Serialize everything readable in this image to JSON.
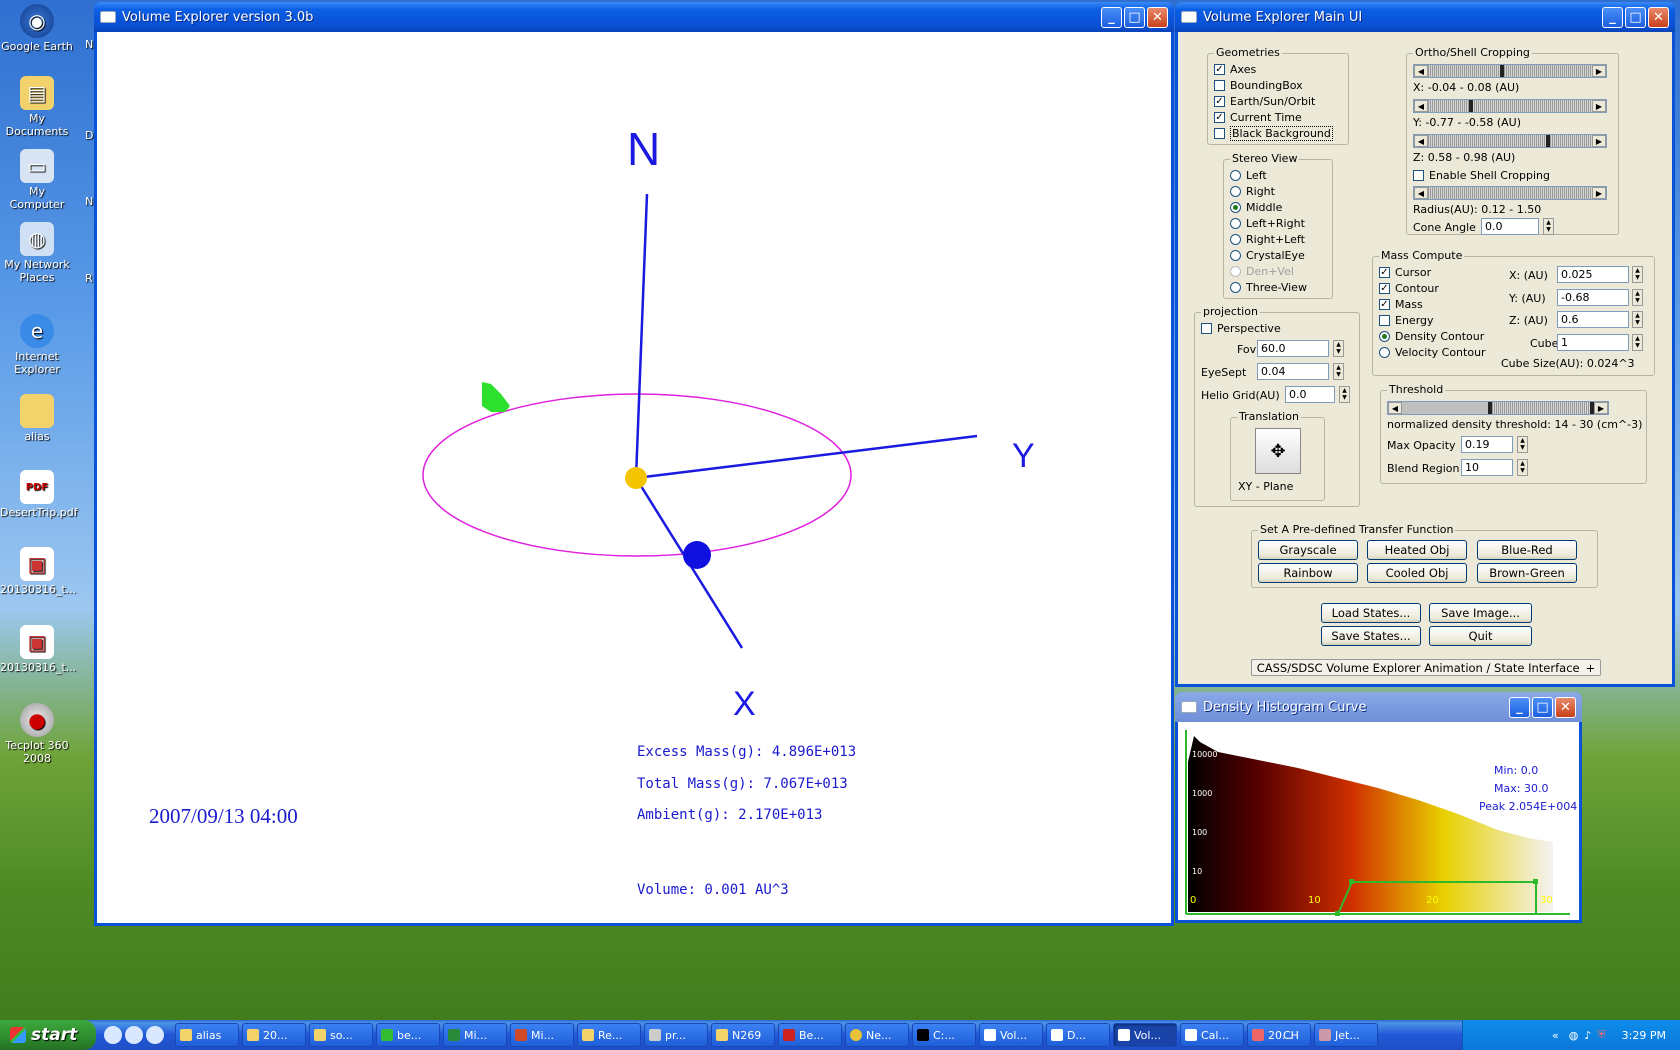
{
  "desktop": {
    "icons": [
      "Google Earth",
      "My Documents",
      "My Computer",
      "My Network Places",
      "Internet Explorer",
      "alias",
      "DesertTrip.pdf",
      "20130316_t...",
      "20130316_t...",
      "Tecplot 360 2008"
    ],
    "edge_letters": [
      "N",
      "D",
      "N",
      "R"
    ]
  },
  "viewer": {
    "title": "Volume Explorer version 3.0b",
    "axis_n": "N",
    "axis_y": "Y",
    "axis_x": "X",
    "excess_mass": "Excess Mass(g): 4.896E+013",
    "total_mass": "Total Mass(g): 7.067E+013",
    "ambient": "Ambient(g): 2.170E+013",
    "volume": "Volume: 0.001 AU^3",
    "date": "2007/09/13 04:00"
  },
  "main_ui": {
    "title": "Volume Explorer Main UI",
    "geometries": {
      "title": "Geometries",
      "items": [
        {
          "label": "Axes",
          "checked": true
        },
        {
          "label": "BoundingBox",
          "checked": false
        },
        {
          "label": "Earth/Sun/Orbit",
          "checked": true
        },
        {
          "label": "Current Time",
          "checked": true
        },
        {
          "label": "Black Background",
          "checked": false
        }
      ]
    },
    "stereo": {
      "title": "Stereo View",
      "items": [
        {
          "label": "Left",
          "selected": false,
          "disabled": false
        },
        {
          "label": "Right",
          "selected": false,
          "disabled": false
        },
        {
          "label": "Middle",
          "selected": true,
          "disabled": false
        },
        {
          "label": "Left+Right",
          "selected": false,
          "disabled": false
        },
        {
          "label": "Right+Left",
          "selected": false,
          "disabled": false
        },
        {
          "label": "CrystalEye",
          "selected": false,
          "disabled": false
        },
        {
          "label": "Den+Vel",
          "selected": false,
          "disabled": true
        },
        {
          "label": "Three-View",
          "selected": false,
          "disabled": false
        }
      ]
    },
    "cropping": {
      "title": "Ortho/Shell Cropping",
      "x_label": "X: -0.04 - 0.08 (AU)",
      "y_label": "Y: -0.77 - -0.58 (AU)",
      "z_label": "Z: 0.58 - 0.98 (AU)",
      "shell_label": "Enable Shell Cropping",
      "radius_label": "Radius(AU): 0.12 - 1.50",
      "cone_label": "Cone Angle",
      "cone_value": "0.0"
    },
    "mass": {
      "title": "Mass Compute",
      "checks": [
        {
          "label": "Cursor",
          "checked": true
        },
        {
          "label": "Contour",
          "checked": true
        },
        {
          "label": "Mass",
          "checked": true
        },
        {
          "label": "Energy",
          "checked": false
        }
      ],
      "radios": [
        {
          "label": "Density Contour",
          "selected": true
        },
        {
          "label": "Velocity Contour",
          "selected": false
        }
      ],
      "x_label": "X: (AU)",
      "x_value": "0.025",
      "y_label": "Y: (AU)",
      "y_value": "-0.68",
      "z_label": "Z: (AU)",
      "z_value": "0.6",
      "cube_label": "Cube",
      "cube_value": "1",
      "cube_size": "Cube Size(AU): 0.024^3"
    },
    "projection": {
      "title": "projection",
      "perspective": "Perspective",
      "fov_label": "Fov",
      "fov_value": "60.0",
      "eyesept_label": "EyeSept",
      "eyesept_value": "0.04",
      "helio_label": "Helio Grid(AU)",
      "helio_value": "0.0",
      "translation_title": "Translation",
      "plane_label": "XY - Plane"
    },
    "threshold": {
      "title": "Threshold",
      "label": "normalized density threshold: 14 - 30 (cm^-3)",
      "opacity_label": "Max Opacity",
      "opacity_value": "0.19",
      "blend_label": "Blend Region",
      "blend_value": "10"
    },
    "transfer": {
      "title": "Set A Pre-defined Transfer Function",
      "buttons": [
        "Grayscale",
        "Heated Obj",
        "Blue-Red",
        "Rainbow",
        "Cooled Obj",
        "Brown-Green"
      ]
    },
    "actions": {
      "load": "Load States...",
      "save_image": "Save Image...",
      "save": "Save States...",
      "quit": "Quit"
    },
    "animation_bar": "CASS/SDSC Volume Explorer Animation / State Interface"
  },
  "histogram": {
    "title": "Density Histogram Curve",
    "min": "Min: 0.0",
    "max": "Max: 30.0",
    "peak": "Peak 2.054E+004",
    "y_ticks": [
      "10000",
      "1000",
      "100",
      "10"
    ],
    "x_ticks": [
      "0",
      "10",
      "20",
      "30"
    ]
  },
  "taskbar": {
    "start": "start",
    "tasks": [
      "alias",
      "20...",
      "so...",
      "be...",
      "Mi...",
      "Mi...",
      "Re...",
      "pr...",
      "N269",
      "Be...",
      "Ne...",
      "C:...",
      "Vol...",
      "D...",
      "Vol...",
      "Cal...",
      "20...",
      "Jet..."
    ],
    "active_index": 14,
    "lang": "CH",
    "clock": "3:29 PM"
  }
}
